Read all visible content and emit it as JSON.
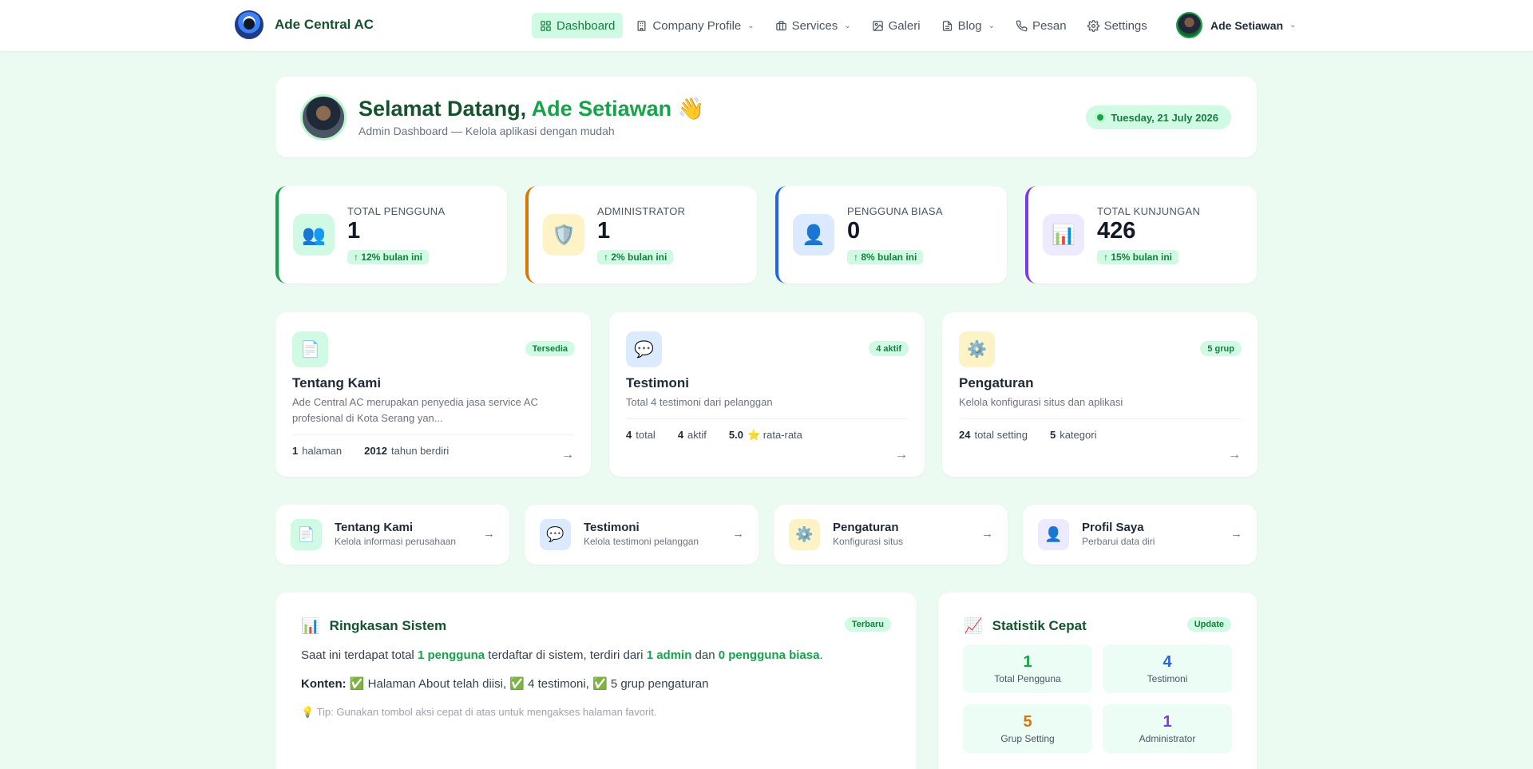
{
  "nav": {
    "brand": "Ade Central AC",
    "items": [
      {
        "label": "Dashboard",
        "icon": "grid-icon",
        "active": true,
        "dropdown": false
      },
      {
        "label": "Company Profile",
        "icon": "building-icon",
        "active": false,
        "dropdown": true
      },
      {
        "label": "Services",
        "icon": "briefcase-icon",
        "active": false,
        "dropdown": true
      },
      {
        "label": "Galeri",
        "icon": "image-icon",
        "active": false,
        "dropdown": false
      },
      {
        "label": "Blog",
        "icon": "document-icon",
        "active": false,
        "dropdown": true
      },
      {
        "label": "Pesan",
        "icon": "phone-icon",
        "active": false,
        "dropdown": false
      },
      {
        "label": "Settings",
        "icon": "gear-icon",
        "active": false,
        "dropdown": false
      }
    ],
    "user": "Ade Setiawan"
  },
  "welcome": {
    "greeting": "Selamat Datang,",
    "name": "Ade Setiawan",
    "emoji": "👋",
    "subtitle": "Admin Dashboard — Kelola aplikasi dengan mudah",
    "date": "Tuesday, 21 July 2026"
  },
  "stats": [
    {
      "label": "TOTAL PENGGUNA",
      "value": "1",
      "trend": "↑ 12% bulan ini",
      "icon": "👥",
      "color": "#16a34a",
      "bg": "#d1fae5"
    },
    {
      "label": "ADMINISTRATOR",
      "value": "1",
      "trend": "↑ 2% bulan ini",
      "icon": "🛡️",
      "color": "#d97706",
      "bg": "#fef3c7"
    },
    {
      "label": "PENGGUNA BIASA",
      "value": "0",
      "trend": "↑ 8% bulan ini",
      "icon": "👤",
      "color": "#2563eb",
      "bg": "#dbeafe"
    },
    {
      "label": "TOTAL KUNJUNGAN",
      "value": "426",
      "trend": "↑ 15% bulan ini",
      "icon": "📊",
      "color": "#7c3aed",
      "bg": "#ede9fe"
    }
  ],
  "features": [
    {
      "title": "Tentang Kami",
      "badge": "Tersedia",
      "icon": "📄",
      "bg": "#d1fae5",
      "desc": "Ade Central AC merupakan penyedia jasa service AC profesional di Kota Serang yan...",
      "meta": [
        {
          "n": "1",
          "l": "halaman"
        },
        {
          "n": "2012",
          "l": "tahun berdiri"
        }
      ]
    },
    {
      "title": "Testimoni",
      "badge": "4 aktif",
      "icon": "💬",
      "bg": "#dbeafe",
      "desc": "Total 4 testimoni dari pelanggan",
      "meta": [
        {
          "n": "4",
          "l": "total"
        },
        {
          "n": "4",
          "l": "aktif"
        },
        {
          "n": "5.0",
          "l": "⭐ rata-rata"
        }
      ]
    },
    {
      "title": "Pengaturan",
      "badge": "5 grup",
      "icon": "⚙️",
      "bg": "#fef3c7",
      "desc": "Kelola konfigurasi situs dan aplikasi",
      "meta": [
        {
          "n": "24",
          "l": "total setting"
        },
        {
          "n": "5",
          "l": "kategori"
        }
      ]
    }
  ],
  "quick_actions": [
    {
      "title": "Tentang Kami",
      "sub": "Kelola informasi perusahaan",
      "icon": "📄",
      "bg": "#d1fae5"
    },
    {
      "title": "Testimoni",
      "sub": "Kelola testimoni pelanggan",
      "icon": "💬",
      "bg": "#dbeafe"
    },
    {
      "title": "Pengaturan",
      "sub": "Konfigurasi situs",
      "icon": "⚙️",
      "bg": "#fef3c7"
    },
    {
      "title": "Profil Saya",
      "sub": "Perbarui data diri",
      "icon": "👤",
      "bg": "#ede9fe"
    }
  ],
  "summary": {
    "title": "Ringkasan Sistem",
    "icon": "📊",
    "badge": "Terbaru",
    "p1_a": "Saat ini terdapat total ",
    "p1_b": "1 pengguna",
    "p1_c": " terdaftar di sistem, terdiri dari ",
    "p1_d": "1 admin",
    "p1_e": " dan ",
    "p1_f": "0 pengguna biasa",
    "p1_g": ".",
    "p2_label": "Konten:",
    "p2_text": " ✅ Halaman About telah diisi, ✅ 4 testimoni, ✅ 5 grup pengaturan",
    "tip": "💡 Tip: Gunakan tombol aksi cepat di atas untuk mengakses halaman favorit."
  },
  "quick_stats": {
    "title": "Statistik Cepat",
    "icon": "📈",
    "badge": "Update",
    "cells": [
      {
        "value": "1",
        "label": "Total Pengguna",
        "color": "#16a34a"
      },
      {
        "value": "4",
        "label": "Testimoni",
        "color": "#2563eb"
      },
      {
        "value": "5",
        "label": "Grup Setting",
        "color": "#d97706"
      },
      {
        "value": "1",
        "label": "Administrator",
        "color": "#7c3aed"
      }
    ]
  }
}
